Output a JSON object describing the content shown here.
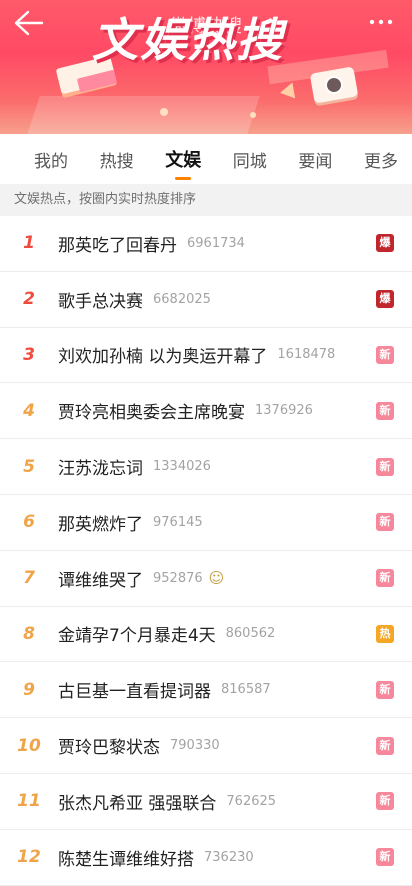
{
  "banner": {
    "title": "文娱热搜",
    "subtitle": "微博热搜"
  },
  "tabs": [
    {
      "label": "我的",
      "active": false
    },
    {
      "label": "热搜",
      "active": false
    },
    {
      "label": "文娱",
      "active": true
    },
    {
      "label": "同城",
      "active": false
    },
    {
      "label": "要闻",
      "active": false
    },
    {
      "label": "更多",
      "active": false
    }
  ],
  "subhead": "文娱热点，按圈内实时热度排序",
  "colors": {
    "accent": "#ff8200",
    "badge_explode": "#c0262b",
    "badge_new": "#f7879a",
    "badge_hot": "#f5a623",
    "rank_top": "#f14b3e",
    "rank_other": "#f0a44a"
  },
  "items": [
    {
      "rank": "1",
      "title": "那英吃了回春丹",
      "heat": "6961734",
      "badge": "爆",
      "badge_type": "explode"
    },
    {
      "rank": "2",
      "title": "歌手总决赛",
      "heat": "6682025",
      "badge": "爆",
      "badge_type": "explode"
    },
    {
      "rank": "3",
      "title": "刘欢加孙楠 以为奥运开幕了",
      "heat": "1618478",
      "badge": "新",
      "badge_type": "new"
    },
    {
      "rank": "4",
      "title": "贾玲亮相奥委会主席晚宴",
      "heat": "1376926",
      "badge": "新",
      "badge_type": "new"
    },
    {
      "rank": "5",
      "title": "汪苏泷忘词",
      "heat": "1334026",
      "badge": "新",
      "badge_type": "new"
    },
    {
      "rank": "6",
      "title": "那英燃炸了",
      "heat": "976145",
      "badge": "新",
      "badge_type": "new"
    },
    {
      "rank": "7",
      "title": "谭维维哭了",
      "heat": "952876",
      "badge": "新",
      "badge_type": "new",
      "emoji": "crying-emoji"
    },
    {
      "rank": "8",
      "title": "金靖孕7个月暴走4天",
      "heat": "860562",
      "badge": "热",
      "badge_type": "hot"
    },
    {
      "rank": "9",
      "title": "古巨基一直看提词器",
      "heat": "816587",
      "badge": "新",
      "badge_type": "new"
    },
    {
      "rank": "10",
      "title": "贾玲巴黎状态",
      "heat": "790330",
      "badge": "新",
      "badge_type": "new"
    },
    {
      "rank": "11",
      "title": "张杰凡希亚 强强联合",
      "heat": "762625",
      "badge": "新",
      "badge_type": "new"
    },
    {
      "rank": "12",
      "title": "陈楚生谭维维好搭",
      "heat": "736230",
      "badge": "新",
      "badge_type": "new"
    }
  ]
}
